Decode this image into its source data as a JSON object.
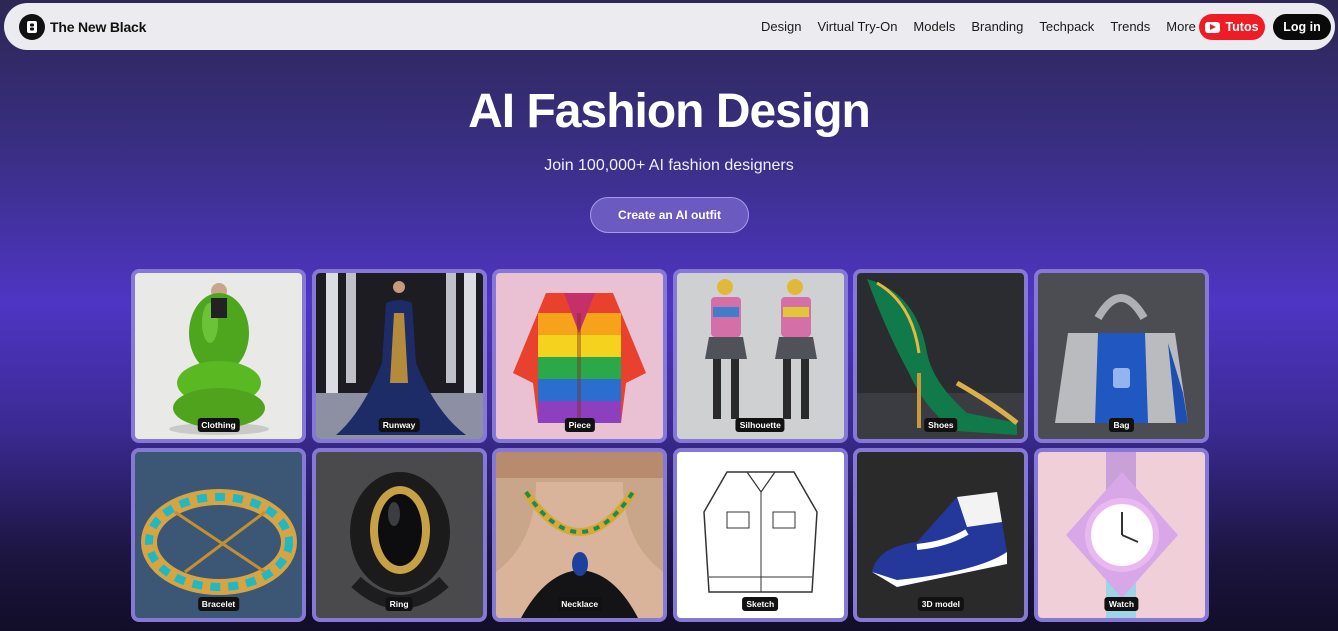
{
  "brand": {
    "name": "The New Black"
  },
  "nav": {
    "links": [
      "Design",
      "Virtual Try-On",
      "Models",
      "Branding",
      "Techpack",
      "Trends"
    ],
    "more": "More",
    "tutos": "Tutos",
    "login": "Log in"
  },
  "hero": {
    "title": "AI Fashion Design",
    "subtitle": "Join 100,000+ AI fashion designers",
    "cta": "Create an AI outfit"
  },
  "cards": [
    {
      "label": "Clothing"
    },
    {
      "label": "Runway"
    },
    {
      "label": "Piece"
    },
    {
      "label": "Silhouette"
    },
    {
      "label": "Shoes"
    },
    {
      "label": "Bag"
    },
    {
      "label": "Bracelet"
    },
    {
      "label": "Ring"
    },
    {
      "label": "Necklace"
    },
    {
      "label": "Sketch"
    },
    {
      "label": "3D model"
    },
    {
      "label": "Watch"
    }
  ],
  "icons": {
    "logo": "logo-mark-icon",
    "youtube": "youtube-icon",
    "chevron": "chevron-down-icon"
  },
  "colors": {
    "tutos": "#ee1c24",
    "login": "#0a0a0a",
    "card_frame": "#8679d6"
  }
}
